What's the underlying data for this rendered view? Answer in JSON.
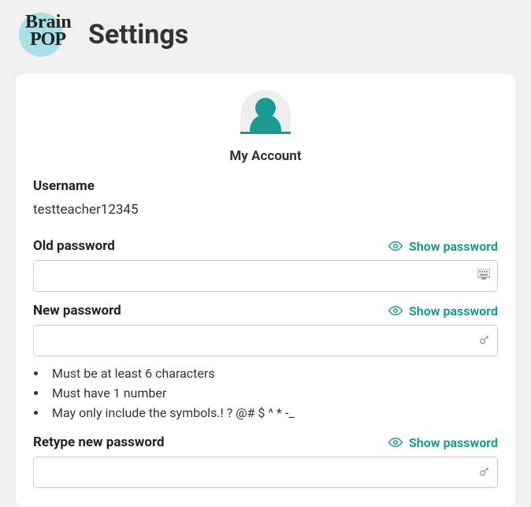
{
  "header": {
    "logo_line1": "Brain",
    "logo_line2": "POP",
    "title": "Settings"
  },
  "account": {
    "section_title": "My Account",
    "username_label": "Username",
    "username_value": "testteacher12345"
  },
  "passwords": {
    "show_label": "Show password",
    "old": {
      "label": "Old password"
    },
    "new": {
      "label": "New password"
    },
    "retype": {
      "label": "Retype new password"
    },
    "rules": [
      "Must be at least 6 characters",
      "Must have 1 number",
      "May only include the symbols.! ? @# $ ^ * -_"
    ]
  }
}
